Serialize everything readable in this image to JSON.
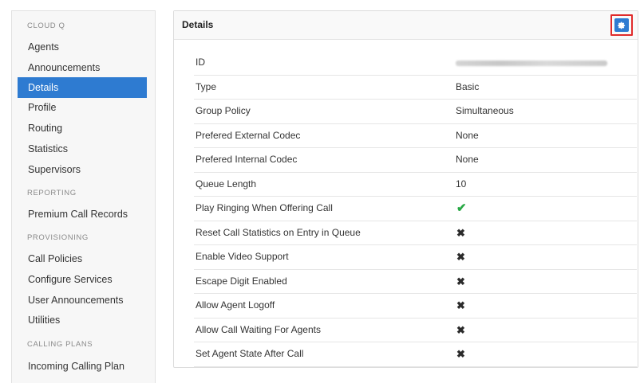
{
  "sidebar": {
    "sections": [
      {
        "title": "CLOUD Q",
        "items": [
          {
            "label": "Agents",
            "active": false
          },
          {
            "label": "Announcements",
            "active": false
          },
          {
            "label": "Details",
            "active": true
          },
          {
            "label": "Profile",
            "active": false
          },
          {
            "label": "Routing",
            "active": false
          },
          {
            "label": "Statistics",
            "active": false
          },
          {
            "label": "Supervisors",
            "active": false
          }
        ]
      },
      {
        "title": "REPORTING",
        "items": [
          {
            "label": "Premium Call Records",
            "active": false
          }
        ]
      },
      {
        "title": "PROVISIONING",
        "items": [
          {
            "label": "Call Policies",
            "active": false
          },
          {
            "label": "Configure Services",
            "active": false
          },
          {
            "label": "User Announcements",
            "active": false
          },
          {
            "label": "Utilities",
            "active": false
          }
        ]
      },
      {
        "title": "CALLING PLANS",
        "items": [
          {
            "label": "Incoming Calling Plan",
            "active": false
          }
        ]
      }
    ]
  },
  "panel": {
    "title": "Details",
    "settings_icon": "gear-icon",
    "accent_color": "#2e7bd1",
    "highlight_color": "#e02b2b"
  },
  "details": [
    {
      "label": "ID",
      "value": "",
      "kind": "blurred"
    },
    {
      "label": "Type",
      "value": "Basic",
      "kind": "text"
    },
    {
      "label": "Group Policy",
      "value": "Simultaneous",
      "kind": "text"
    },
    {
      "label": "Prefered External Codec",
      "value": "None",
      "kind": "text"
    },
    {
      "label": "Prefered Internal Codec",
      "value": "None",
      "kind": "text"
    },
    {
      "label": "Queue Length",
      "value": "10",
      "kind": "text"
    },
    {
      "label": "Play Ringing When Offering Call",
      "value": true,
      "kind": "bool"
    },
    {
      "label": "Reset Call Statistics on Entry in Queue",
      "value": false,
      "kind": "bool"
    },
    {
      "label": "Enable Video Support",
      "value": false,
      "kind": "bool"
    },
    {
      "label": "Escape Digit Enabled",
      "value": false,
      "kind": "bool"
    },
    {
      "label": "Allow Agent Logoff",
      "value": false,
      "kind": "bool"
    },
    {
      "label": "Allow Call Waiting For Agents",
      "value": false,
      "kind": "bool"
    },
    {
      "label": "Set Agent State After Call",
      "value": false,
      "kind": "bool"
    }
  ]
}
